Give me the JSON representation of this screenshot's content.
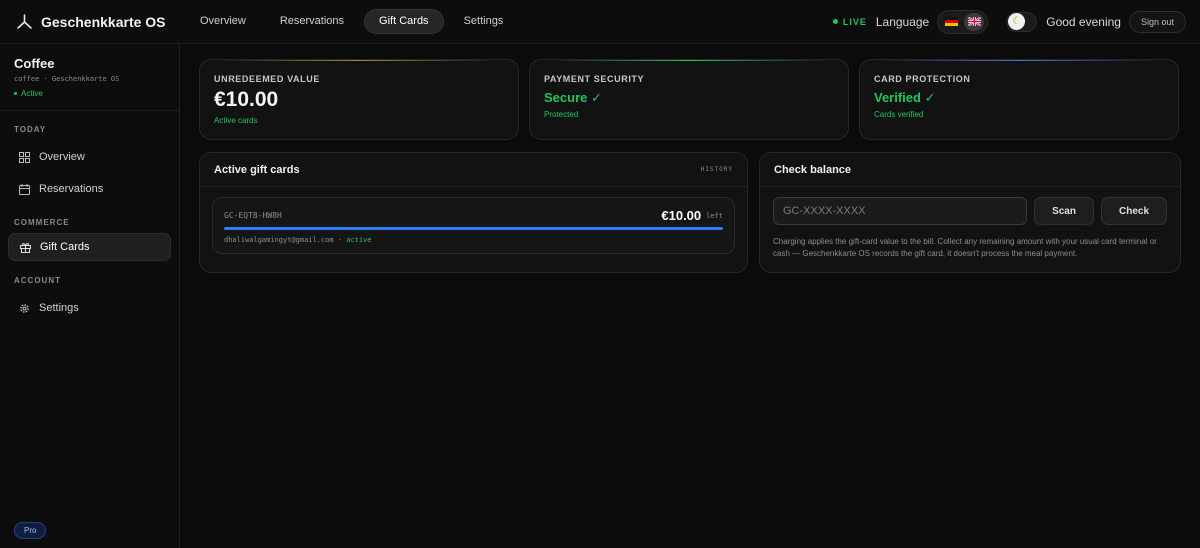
{
  "app": {
    "name": "Geschenkkarte OS"
  },
  "nav": {
    "tabs": [
      {
        "label": "Overview"
      },
      {
        "label": "Reservations"
      },
      {
        "label": "Gift Cards"
      },
      {
        "label": "Settings"
      }
    ],
    "active": "Gift Cards"
  },
  "header": {
    "live_label": "LIVE",
    "language_label": "Language",
    "greeting": "Good evening",
    "signout_label": "Sign out"
  },
  "workspace": {
    "name": "Coffee",
    "subtitle": "coffee · Geschenkkarte OS",
    "status": "Active"
  },
  "sidebar": {
    "sections": [
      {
        "label": "TODAY",
        "items": [
          {
            "label": "Overview",
            "icon": "grid-icon"
          },
          {
            "label": "Reservations",
            "icon": "calendar-icon"
          }
        ]
      },
      {
        "label": "COMMERCE",
        "items": [
          {
            "label": "Gift Cards",
            "icon": "gift-icon"
          }
        ]
      },
      {
        "label": "ACCOUNT",
        "items": [
          {
            "label": "Settings",
            "icon": "gear-icon"
          }
        ]
      }
    ],
    "plan_badge": "Pro"
  },
  "stats": [
    {
      "label": "UNREDEEMED VALUE",
      "value": "€10.00",
      "hint": "Active cards",
      "accent": "#a0873a"
    },
    {
      "label": "PAYMENT SECURITY",
      "value": "Secure ✓",
      "hint": "Protected",
      "accent": "#22c55e"
    },
    {
      "label": "CARD PROTECTION",
      "value": "Verified ✓",
      "hint": "Cards verified",
      "accent": "#4f6bd8"
    }
  ],
  "active_cards": {
    "title": "Active gift cards",
    "history_label": "HISTORY",
    "cards": [
      {
        "code": "GC-EQT8-HW8H",
        "amount": "€10.00",
        "left_label": "left",
        "email": "dhaliwalgamingyt@gmail.com",
        "separator": "·",
        "status": "active",
        "remaining_fraction": 1.0
      }
    ]
  },
  "check_balance": {
    "title": "Check balance",
    "placeholder": "GC-XXXX-XXXX",
    "scan_label": "Scan",
    "check_label": "Check",
    "note": "Charging applies the gift-card value to the bill. Collect any remaining amount with your usual card terminal or cash — Geschenkkarte OS records the gift card, it doesn't process the meal payment."
  },
  "colors": {
    "live": "#22c55e",
    "progress": "#2f7df6"
  }
}
